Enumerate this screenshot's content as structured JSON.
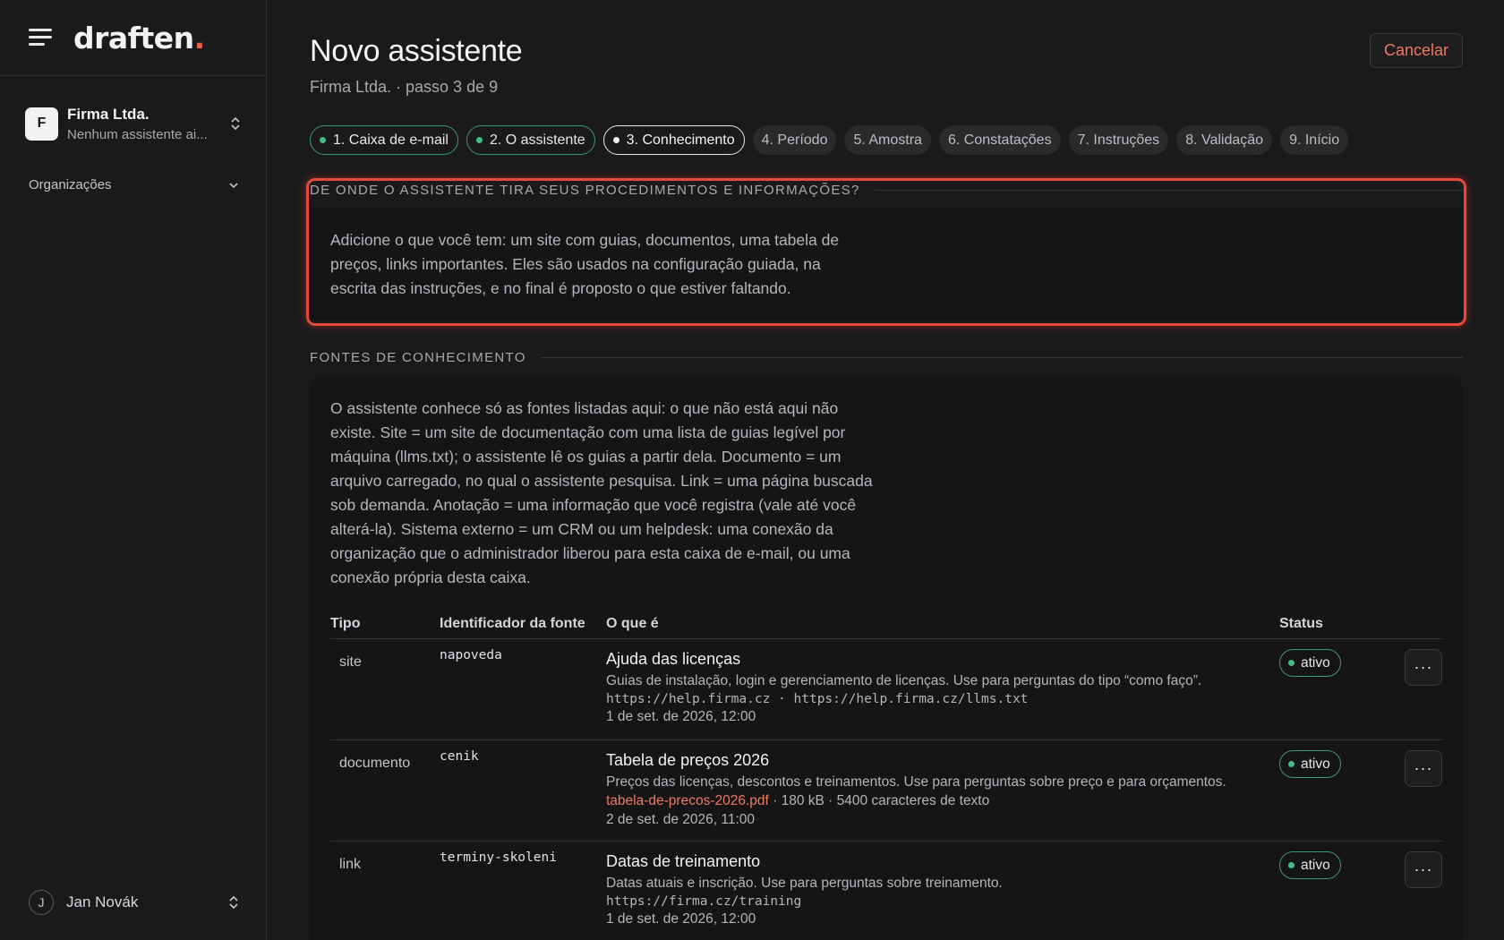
{
  "sidebar": {
    "logo": "draften",
    "logo_dot": ".",
    "org": {
      "initial": "F",
      "name": "Firma Ltda.",
      "sub": "Nenhum assistente ai..."
    },
    "orgs_label": "Organizações",
    "user": {
      "initial": "J",
      "name": "Jan Novák"
    }
  },
  "header": {
    "title": "Novo assistente",
    "subtitle": "Firma Ltda. · passo 3 de 9",
    "cancel_label": "Cancelar"
  },
  "steps": [
    {
      "label": "1. Caixa de e-mail",
      "state": "done"
    },
    {
      "label": "2. O assistente",
      "state": "done"
    },
    {
      "label": "3. Conhecimento",
      "state": "current"
    },
    {
      "label": "4. Período",
      "state": "todo"
    },
    {
      "label": "5. Amostra",
      "state": "todo"
    },
    {
      "label": "6. Constatações",
      "state": "todo"
    },
    {
      "label": "7. Instruções",
      "state": "todo"
    },
    {
      "label": "8. Validação",
      "state": "todo"
    },
    {
      "label": "9. Início",
      "state": "todo"
    }
  ],
  "section1": {
    "heading": "DE ONDE O ASSISTENTE TIRA SEUS PROCEDIMENTOS E INFORMAÇÕES?",
    "body": "Adicione o que você tem: um site com guias, documentos, uma tabela de preços, links importantes. Eles são usados na configuração guiada, na escrita das instruções, e no final é proposto o que estiver faltando."
  },
  "section2": {
    "heading": "FONTES DE CONHECIMENTO",
    "intro": "O assistente conhece só as fontes listadas aqui: o que não está aqui não existe. Site = um site de documentação com uma lista de guias legível por máquina (llms.txt); o assistente lê os guias a partir dela. Documento = um arquivo carregado, no qual o assistente pesquisa. Link = uma página buscada sob demanda. Anotação = uma informação que você registra (vale até você alterá-la). Sistema externo = um CRM ou um helpdesk: uma conexão da organização que o administrador liberou para esta caixa de e-mail, ou uma conexão própria desta caixa.",
    "columns": {
      "type": "Tipo",
      "id": "Identificador da fonte",
      "what": "O que é",
      "status": "Status"
    },
    "rows": [
      {
        "type": "site",
        "id": "napoveda",
        "title": "Ajuda das licenças",
        "desc": "Guias de instalação, login e gerenciamento de licenças. Use para perguntas do tipo “como faço”.",
        "urls": "https://help.firma.cz · https://help.firma.cz/llms.txt",
        "date": "1 de set. de 2026, 12:00",
        "status": "ativo"
      },
      {
        "type": "documento",
        "id": "cenik",
        "title": "Tabela de preços 2026",
        "desc": "Preços das licenças, descontos e treinamentos. Use para perguntas sobre preço e para orçamentos.",
        "file": "tabela-de-precos-2026.pdf",
        "file_meta": " · 180 kB · 5400 caracteres de texto",
        "date": "2 de set. de 2026, 11:00",
        "status": "ativo"
      },
      {
        "type": "link",
        "id": "terminy-skoleni",
        "title": "Datas de treinamento",
        "desc": "Datas atuais e inscrição. Use para perguntas sobre treinamento.",
        "urls": "https://firma.cz/training",
        "date": "1 de set. de 2026, 12:00",
        "status": "ativo"
      }
    ],
    "more_label": "···"
  },
  "colors": {
    "accent": "#ef5a45",
    "success": "#3fbf86",
    "highlight": "#e8483a"
  }
}
